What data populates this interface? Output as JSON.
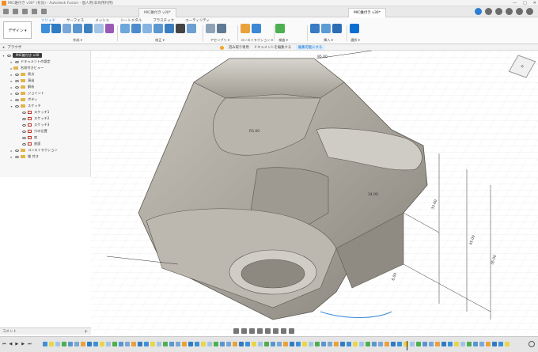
{
  "titlebar": {
    "title": "MIC錐付き v30* (有効) - Autodesk Fusion - 個人用(非商用利用)",
    "win_buttons": [
      "—",
      "□",
      "✕"
    ]
  },
  "tabs": [
    {
      "label": "MIC錐付き v30*"
    },
    {
      "label": "MIC錐付き v30*"
    }
  ],
  "ribbon": {
    "workspace_label": "デザイン ▾",
    "tabs": [
      "ソリッド",
      "サーフェス",
      "メッシュ",
      "シートメタル",
      "プラスチック",
      "ユーティリティ"
    ],
    "active_tab": "ソリッド",
    "groups": [
      "作成 ▾",
      "修正 ▾",
      "アセンブリ ▾",
      "コンストラクション ▾",
      "検査 ▾",
      "挿入 ▾",
      "選択 ▾"
    ]
  },
  "browser": {
    "header": "ブラウザ",
    "items": [
      {
        "label": "MIC錐付き v30",
        "level": 0,
        "type": "root"
      },
      {
        "label": "ドキュメントの設定",
        "level": 1,
        "type": "gear"
      },
      {
        "label": "名前付きビュー",
        "level": 1,
        "type": "folder"
      },
      {
        "label": "原点",
        "level": 1,
        "type": "folder"
      },
      {
        "label": "演出",
        "level": 1,
        "type": "folder"
      },
      {
        "label": "解析",
        "level": 1,
        "type": "folder"
      },
      {
        "label": "ジョイント",
        "level": 1,
        "type": "folder"
      },
      {
        "label": "ボディ",
        "level": 1,
        "type": "folder"
      },
      {
        "label": "スケッチ",
        "level": 1,
        "type": "folder"
      },
      {
        "label": "スケッチ1",
        "level": 2,
        "type": "sketch"
      },
      {
        "label": "スケッチ2",
        "level": 2,
        "type": "sketch"
      },
      {
        "label": "スケッチ3",
        "level": 2,
        "type": "sketch"
      },
      {
        "label": "穴の位置",
        "level": 2,
        "type": "sketch"
      },
      {
        "label": "底",
        "level": 2,
        "type": "sketch"
      },
      {
        "label": "底面",
        "level": 2,
        "type": "sketch"
      },
      {
        "label": "コンストラクション",
        "level": 1,
        "type": "folder"
      },
      {
        "label": "錐 付き",
        "level": 1,
        "type": "folder"
      }
    ]
  },
  "notice": {
    "items": [
      "読み取り専用",
      "ドキュメントを編集する",
      "編集可能にする"
    ]
  },
  "comments": {
    "label": "コメント"
  },
  "viewcube": {
    "label": "右"
  },
  "dimensions": [
    {
      "label": "95.00"
    },
    {
      "label": "R5.00"
    },
    {
      "label": "34.00"
    },
    {
      "label": "33.00"
    },
    {
      "label": "45.00"
    },
    {
      "label": "36.00"
    },
    {
      "label": "6.00"
    }
  ],
  "colors": {
    "accent": "#0b6ed1",
    "model": "#a9a59c",
    "model_dark": "#6f6b63",
    "grid": "#e6e6e6"
  }
}
